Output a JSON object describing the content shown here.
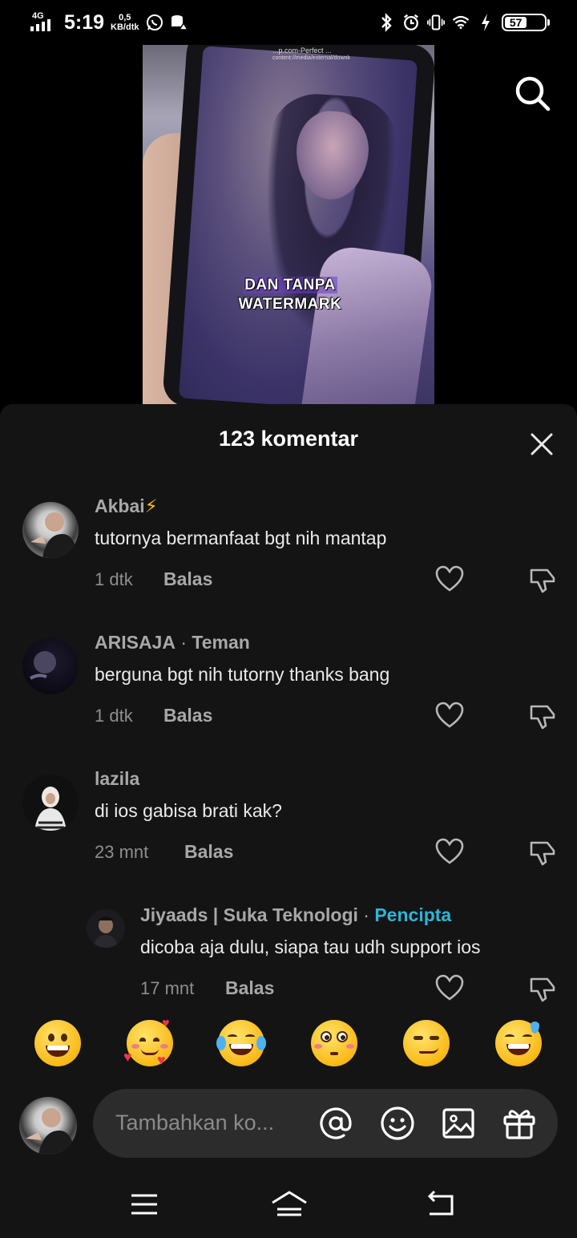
{
  "status_bar": {
    "network": "4G",
    "time": "5:19",
    "speed_value": "0,5",
    "speed_unit": "KB/dtk",
    "battery": "57",
    "icons": [
      "whatsapp-icon",
      "database-icon",
      "bluetooth-icon",
      "alarm-icon",
      "vibrate-icon",
      "wifi-icon",
      "charging-icon"
    ]
  },
  "video": {
    "overlay_line1": "DAN TANPA",
    "overlay_line2": "WATERMARK",
    "url_line1": "...p.com-Perfect ...",
    "url_line2": "content://media/external/downk"
  },
  "sheet": {
    "title": "123 komentar"
  },
  "comments": [
    {
      "name": "Akbai",
      "name_suffix": "⚡",
      "text": "tutornya bermanfaat bgt nih mantap",
      "time": "1 dtk",
      "reply": "Balas"
    },
    {
      "name": "ARISAJA",
      "tag": "Teman",
      "text": "berguna bgt nih tutorny thanks bang",
      "time": "1 dtk",
      "reply": "Balas"
    },
    {
      "name": "lazila",
      "text": "di ios gabisa brati kak?",
      "time": "23 mnt",
      "reply": "Balas"
    },
    {
      "name": "Jiyaads | Suka Teknologi",
      "tag": "Pencipta",
      "text": "dicoba aja dulu, siapa tau udh support ios",
      "time": "17 mnt",
      "reply": "Balas"
    }
  ],
  "emojis": [
    "grinning-face",
    "smiling-face-with-hearts",
    "tears-of-joy",
    "flushed-face",
    "smirking-face",
    "grinning-sweat"
  ],
  "input": {
    "placeholder": "Tambahkan ko..."
  },
  "colors": {
    "sheet_bg": "#141414",
    "creator_tag": "#2fb4d8",
    "input_bg": "#2c2c2c"
  }
}
